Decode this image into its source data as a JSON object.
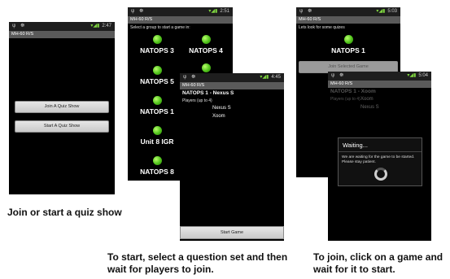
{
  "phone1": {
    "status": {
      "icons_left": "ψ ☸",
      "time": "2:47"
    },
    "app_title": "MH-60 R/S",
    "join_button": "Join A Quiz Show",
    "start_button": "Start A Quiz Show"
  },
  "phone2": {
    "status": {
      "icons_left": "ψ ☸",
      "time": "2:51"
    },
    "app_title": "MH-60 R/S",
    "prompt": "Select a group to start a game in:",
    "groups": [
      "NATOPS 3",
      "NATOPS 4",
      "NATOPS 5",
      "NATOPS 1",
      "Unit 8 IGR",
      "NATOPS 8"
    ]
  },
  "phone3": {
    "status": {
      "icons_left": "ψ ☸",
      "time": "4:45"
    },
    "app_title": "MH-60 R/S",
    "game_title": "NATOPS 1 - Nexus S",
    "players_label": "Players (up to 4)",
    "players": [
      "Nexus S",
      "Xoom"
    ],
    "start_game_button": "Start Game"
  },
  "phone4": {
    "status": {
      "icons_left": "ψ ☸",
      "time": "5:03"
    },
    "app_title": "MH-60 R/S",
    "prompt": "Lets look for some quizes",
    "game": "NATOPS 1",
    "join_button": "Join Selected Game"
  },
  "phone5": {
    "status": {
      "icons_left": "ψ ☸",
      "time": "5:04"
    },
    "app_title": "MH-60 R/S",
    "game_title": "NATOPS 1 - Xoom",
    "players_label": "Players (up to 4)",
    "players": [
      "Xoom",
      "Nexus S"
    ],
    "dialog_title": "Waiting...",
    "dialog_message": "We are waiting for the game to be started. Please stay patient."
  },
  "captions": {
    "left": "Join or start a quiz show",
    "middle": "To start, select a question set and then wait for players to join.",
    "right": "To join, click on a game and wait for it to start."
  },
  "colors": {
    "accent_green": "#4fc21b",
    "phone_bg": "#000000",
    "titlebar": "#5a5a5a"
  }
}
